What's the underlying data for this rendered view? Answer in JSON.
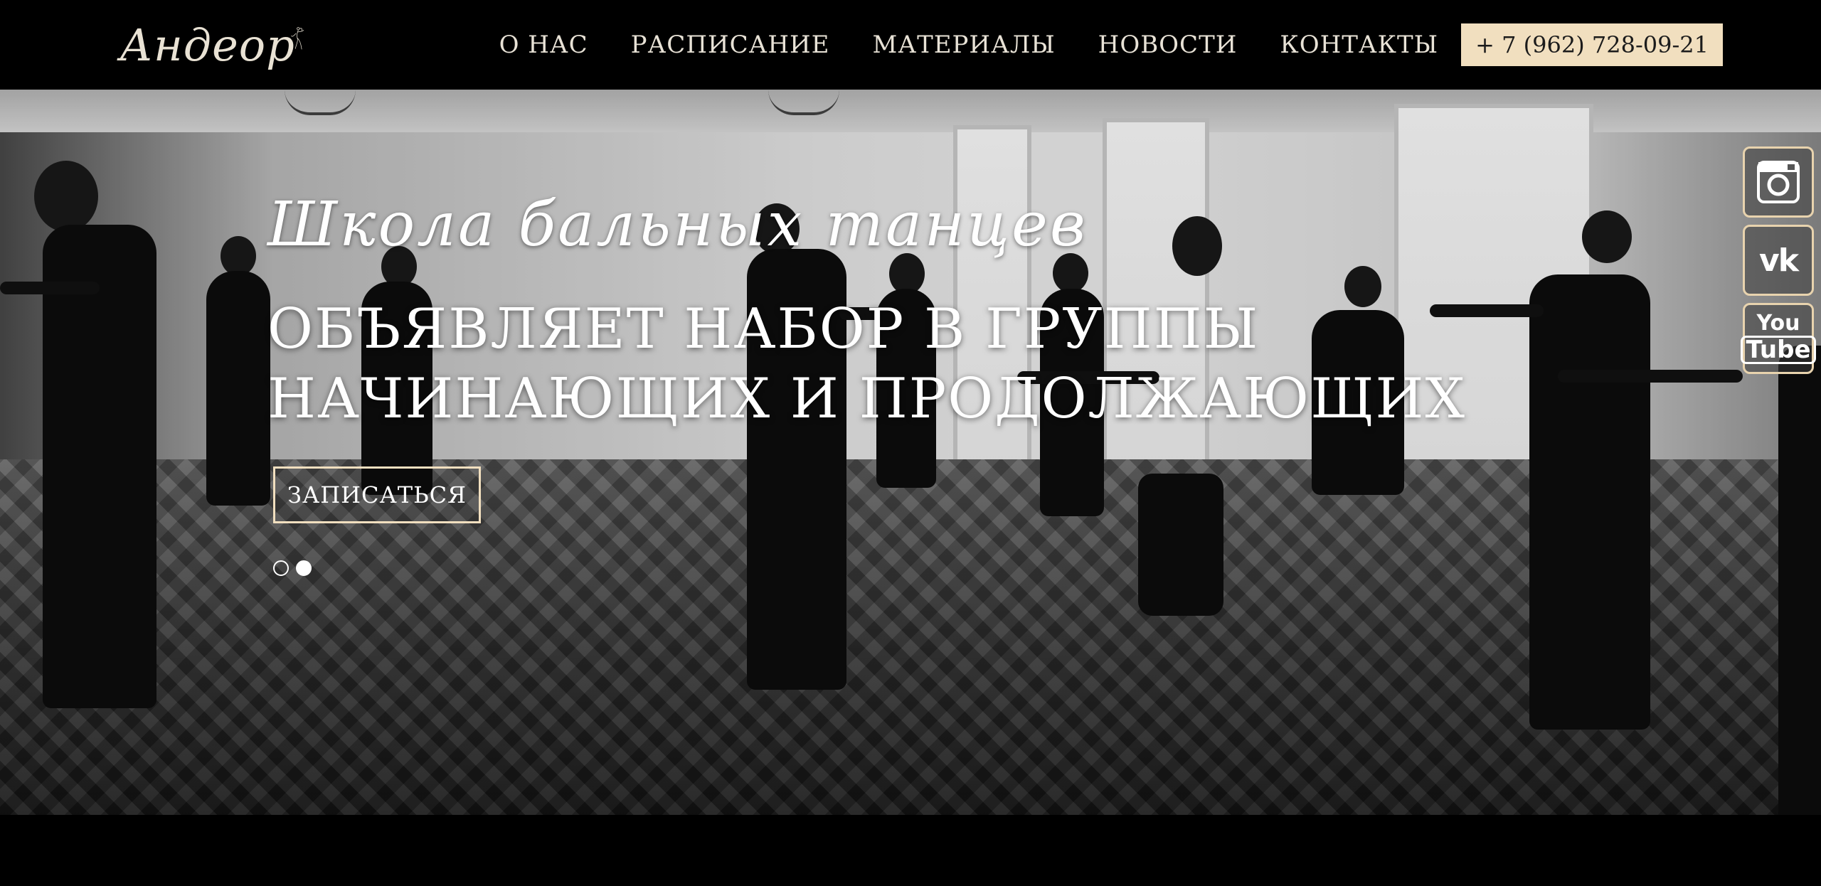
{
  "header": {
    "logo_text": "Андеор",
    "nav": [
      {
        "label": "О НАС"
      },
      {
        "label": "РАСПИСАНИЕ"
      },
      {
        "label": "МАТЕРИАЛЫ"
      },
      {
        "label": "НОВОСТИ"
      },
      {
        "label": "КОНТАКТЫ"
      }
    ],
    "phone": "+ 7 (962) 728-09-21"
  },
  "hero": {
    "subtitle": "Школа бальных танцев",
    "title_line1": "ОБЪЯВЛЯЕТ НАБОР В ГРУППЫ",
    "title_line2": "НАЧИНАЮЩИХ И ПРОДОЛЖАЮЩИХ",
    "button_label": "ЗАПИСАТЬСЯ",
    "slides": {
      "count": 2,
      "active_index": 1
    }
  },
  "social": [
    {
      "name": "instagram-icon"
    },
    {
      "name": "vk-icon",
      "label": "vk"
    },
    {
      "name": "youtube-icon",
      "label_top": "You",
      "label_bottom": "Tube"
    }
  ],
  "colors": {
    "accent": "#f1dfbf",
    "background": "#000000",
    "text": "#e8e2d6"
  }
}
